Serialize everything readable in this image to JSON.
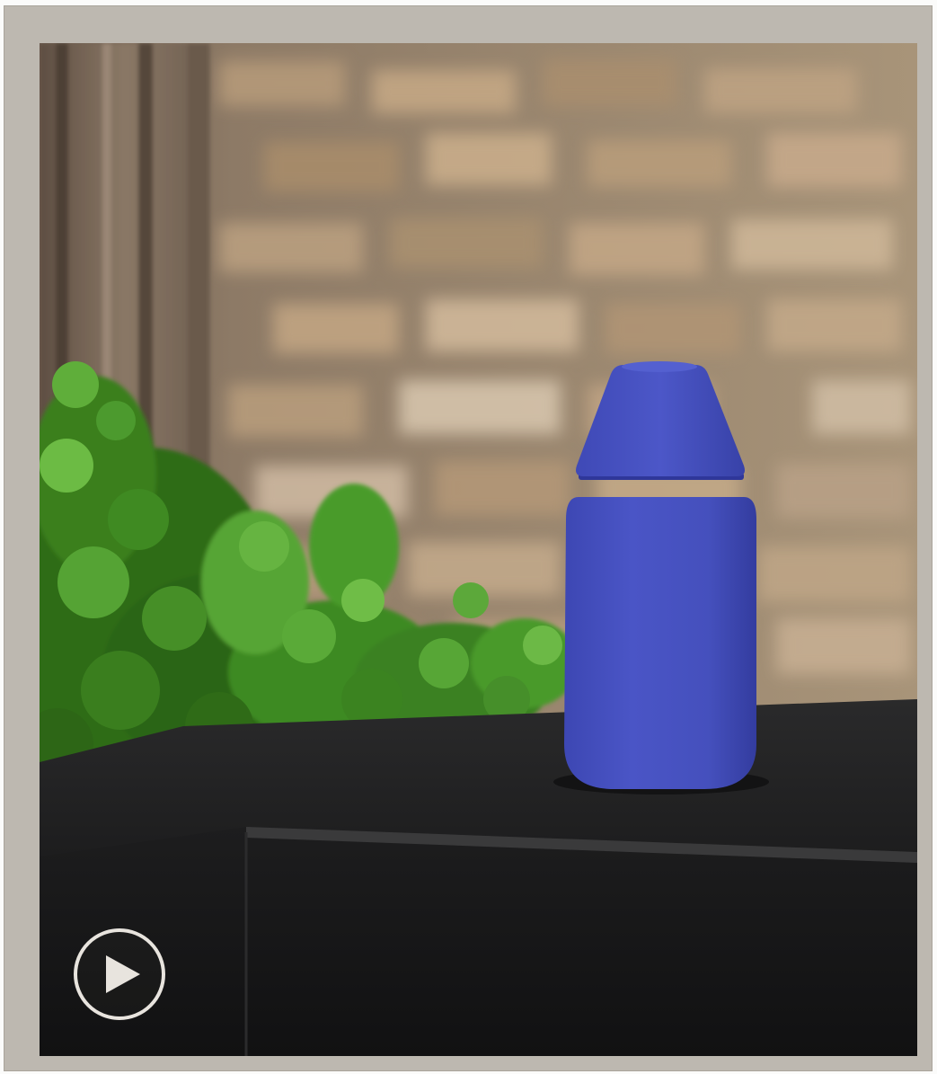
{
  "media": {
    "type": "video",
    "subject": "blue-bottle-on-countertop",
    "colors": {
      "frame": "#bdb8b0",
      "bottle": "#4a55c4",
      "counter": "#1c1c1d",
      "herbs": "#3f7d1e",
      "brick": "#a8916f"
    },
    "controls": {
      "play_icon": "play-icon"
    }
  }
}
